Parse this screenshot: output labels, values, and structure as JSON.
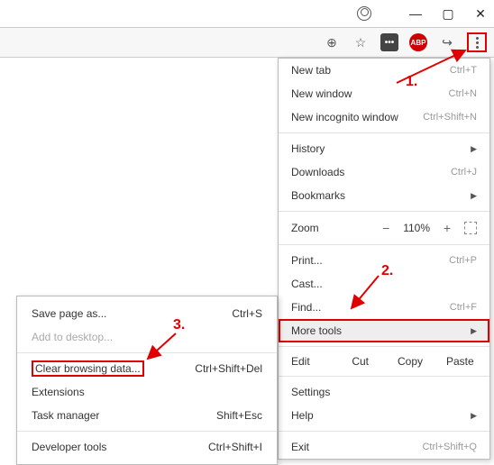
{
  "window": {
    "profile_alt": "profile"
  },
  "toolbar": {
    "ext1": "•••",
    "ext2": "ABP"
  },
  "menu": {
    "new_tab": "New tab",
    "new_tab_sc": "Ctrl+T",
    "new_window": "New window",
    "new_window_sc": "Ctrl+N",
    "incognito": "New incognito window",
    "incognito_sc": "Ctrl+Shift+N",
    "history": "History",
    "downloads": "Downloads",
    "downloads_sc": "Ctrl+J",
    "bookmarks": "Bookmarks",
    "zoom_label": "Zoom",
    "zoom_minus": "−",
    "zoom_val": "110%",
    "zoom_plus": "+",
    "print": "Print...",
    "print_sc": "Ctrl+P",
    "cast": "Cast...",
    "find": "Find...",
    "find_sc": "Ctrl+F",
    "more_tools": "More tools",
    "edit": "Edit",
    "cut": "Cut",
    "copy": "Copy",
    "paste": "Paste",
    "settings": "Settings",
    "help": "Help",
    "exit": "Exit",
    "exit_sc": "Ctrl+Shift+Q"
  },
  "submenu": {
    "save_page": "Save page as...",
    "save_page_sc": "Ctrl+S",
    "add_desktop": "Add to desktop...",
    "clear_data": "Clear browsing data...",
    "clear_data_sc": "Ctrl+Shift+Del",
    "extensions": "Extensions",
    "task_mgr": "Task manager",
    "task_mgr_sc": "Shift+Esc",
    "dev_tools": "Developer tools",
    "dev_tools_sc": "Ctrl+Shift+I"
  },
  "anno": {
    "n1": "1.",
    "n2": "2.",
    "n3": "3."
  }
}
